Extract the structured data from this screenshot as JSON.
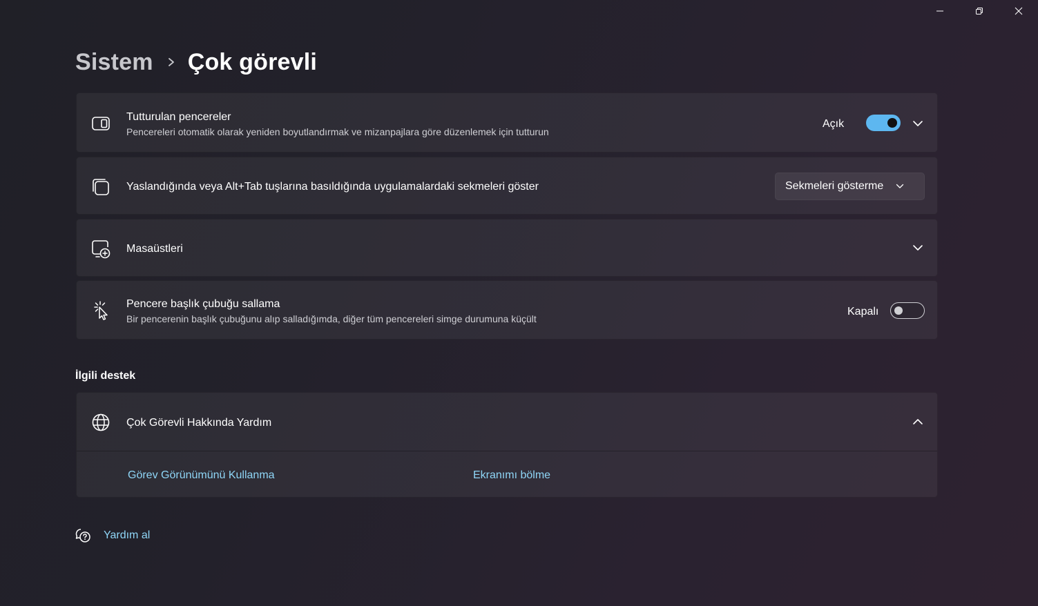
{
  "window": {
    "controls": [
      "minimize",
      "restore",
      "close"
    ]
  },
  "breadcrumb": {
    "parent": "Sistem",
    "separator_icon": "chevron-right-icon",
    "current": "Çok görevli"
  },
  "settings": [
    {
      "id": "snap-windows",
      "icon": "snap-window-icon",
      "title": "Tutturulan pencereler",
      "description": "Pencereleri otomatik olarak yeniden boyutlandırmak ve mizanpajlara göre düzenlemek için tutturun",
      "state_label": "Açık",
      "toggle_on": true,
      "expandable": true
    },
    {
      "id": "alt-tab",
      "icon": "stacked-windows-icon",
      "title": "Yaslandığında veya Alt+Tab tuşlarına basıldığında uygulamalardaki sekmeleri göster",
      "dropdown_value": "Sekmeleri gösterme"
    },
    {
      "id": "desktops",
      "icon": "add-desktop-icon",
      "title": "Masaüstleri",
      "expandable": true
    },
    {
      "id": "title-bar-shake",
      "icon": "shake-cursor-icon",
      "title": "Pencere başlık çubuğu sallama",
      "description": "Bir pencerenin başlık çubuğunu alıp salladığımda, diğer tüm pencereleri simge durumuna küçült",
      "state_label": "Kapalı",
      "toggle_on": false
    }
  ],
  "related_support": {
    "heading": "İlgili destek",
    "help_item": {
      "icon": "globe-icon",
      "title": "Çok Görevli Hakkında Yardım",
      "expanded": true,
      "links": [
        "Görev Görünümünü Kullanma",
        "Ekranımı bölme"
      ]
    }
  },
  "get_help": {
    "icon": "help-chat-icon",
    "label": "Yardım al"
  },
  "colors": {
    "accent": "#5db7f0",
    "link": "#8fd6f7",
    "background": "#23212b"
  }
}
